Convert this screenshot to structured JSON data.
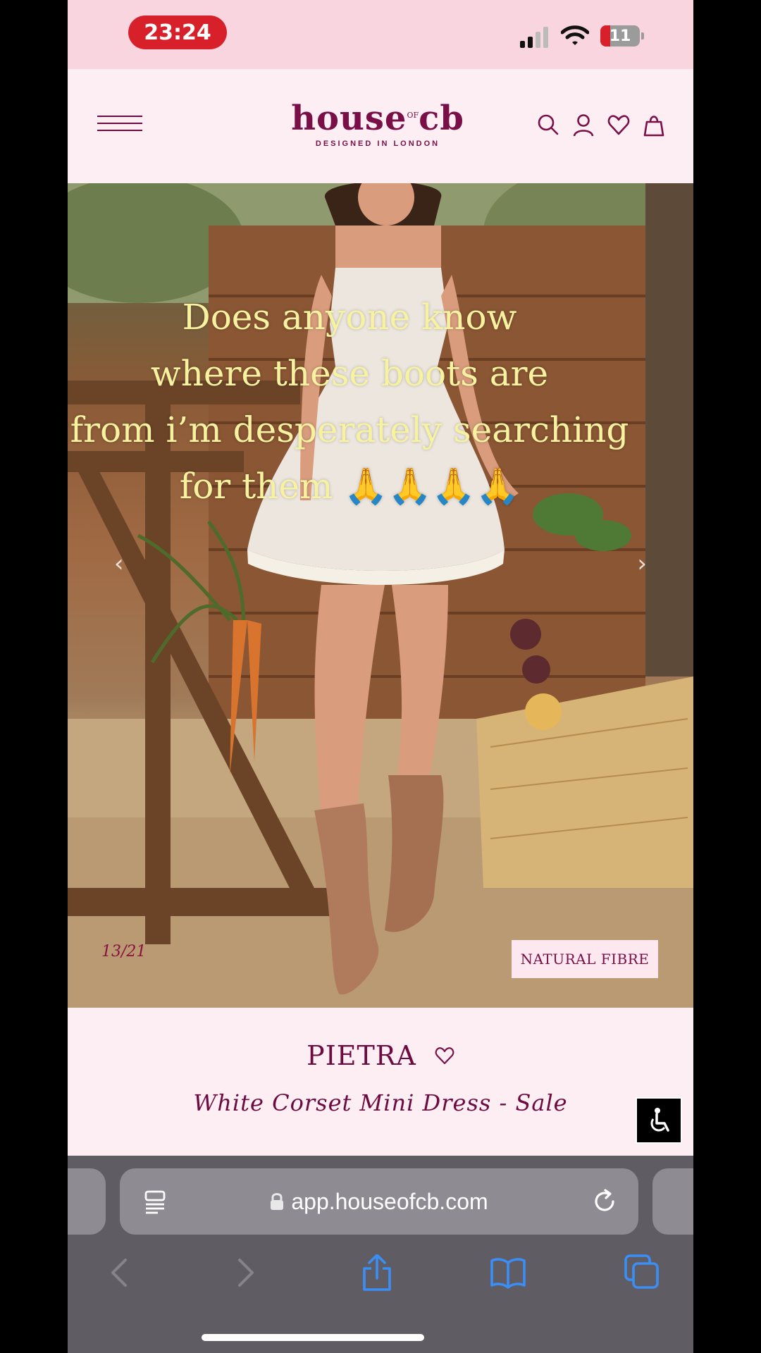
{
  "status_bar": {
    "time": "23:24",
    "battery": "11"
  },
  "header": {
    "logo_main": "house",
    "logo_of": "OF",
    "logo_end": "cb",
    "logo_tagline": "DESIGNED IN LONDON"
  },
  "hero": {
    "overlay_lines": [
      "Does anyone know",
      "where these boots are",
      "from i’m desperately searching",
      "for them 🙏🙏🙏🙏"
    ],
    "counter": "13/21",
    "badge": "NATURAL FIBRE"
  },
  "product": {
    "name": "PIETRA",
    "description": "White Corset Mini Dress - Sale"
  },
  "browser": {
    "url": "app.houseofcb.com"
  },
  "colors": {
    "brand": "#7a0f47",
    "header_bg": "#fdeef3",
    "status_bg": "#f9d6df",
    "overlay_text": "#f7f2a0",
    "toolbar_accent": "#3a8ef6"
  }
}
